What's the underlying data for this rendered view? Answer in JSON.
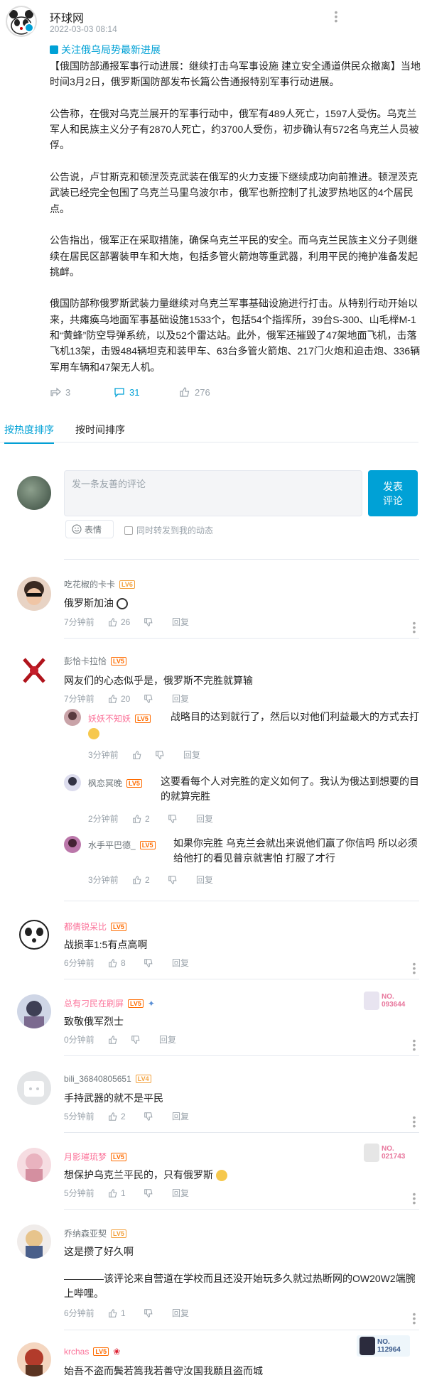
{
  "post": {
    "author": "环球网",
    "time": "2022-03-03 08:14",
    "topic": "关注俄乌局势最新进展",
    "paragraphs": [
      "【俄国防部通报军事行动进展：继续打击乌军事设施 建立安全通道供民众撤离】当地时间3月2日，俄罗斯国防部发布长篇公告通报特别军事行动进展。",
      "公告称，在俄对乌克兰展开的军事行动中，俄军有489人死亡，1597人受伤。乌克兰军人和民族主义分子有2870人死亡，约3700人受伤，初步确认有572名乌克兰人员被俘。",
      "公告说，卢甘斯克和顿涅茨克武装在俄军的火力支援下继续成功向前推进。顿涅茨克武装已经完全包围了乌克兰马里乌波尔市，俄军也新控制了扎波罗热地区的4个居民点。",
      "公告指出，俄军正在采取措施，确保乌克兰平民的安全。而乌克兰民族主义分子则继续在居民区部署装甲车和大炮，包括多管火箭炮等重武器，利用平民的掩护准备发起挑衅。",
      "俄国防部称俄罗斯武装力量继续对乌克兰军事基础设施进行打击。从特别行动开始以来，共瘫痪乌地面军事基础设施1533个，包括54个指挥所，39台S-300、山毛榉M-1和“黄蜂”防空导弹系统，以及52个雷达站。此外，俄军还摧毁了47架地面飞机，击落飞机13架，击毁484辆坦克和装甲车、63台多管火箭炮、217门火炮和迫击炮、336辆军用车辆和47架无人机。"
    ],
    "forward_count": "3",
    "comment_count": "31",
    "like_count": "276"
  },
  "tabs": {
    "hot": "按热度排序",
    "time": "按时间排序"
  },
  "composer": {
    "placeholder": "发一条友善的评论",
    "submit_line1": "发表",
    "submit_line2": "评论",
    "emoji_label": "表情",
    "forward_label": "同时转发到我的动态"
  },
  "reply_label": "回复",
  "colors": {
    "accent": "#00a1d6",
    "vip": "#fb7299",
    "level_orange": "#f2a03b",
    "level_red": "#ff6c00"
  },
  "comments": [
    {
      "name": "吃花椒的卡卡",
      "level": "LV6",
      "text": "俄罗斯加油",
      "time": "7分钟前",
      "likes": "26"
    },
    {
      "name": "彭恰卡拉恰",
      "level": "LV5",
      "text": "网友们的心态似乎是，俄罗斯不完胜就算输",
      "time": "7分钟前",
      "likes": "20",
      "replies": [
        {
          "name": "妖妖不知妖",
          "level": "LV5",
          "text": "战略目的达到就行了，然后以对他们利益最大的方式去打",
          "time": "3分钟前",
          "likes": ""
        },
        {
          "name": "枫恋冥晚",
          "level": "LV5",
          "text": "这要看每个人对完胜的定义如何了。我认为俄达到想要的目的就算完胜",
          "time": "2分钟前",
          "likes": "2"
        },
        {
          "name": "水手平巴德_",
          "level": "LV5",
          "text": "如果你完胜 乌克兰会就出来说他们赢了你信吗 所以必须给他打的看见普京就害怕 打服了才行",
          "time": "3分钟前",
          "likes": "2"
        }
      ]
    },
    {
      "name": "都倩锐呆比",
      "level": "LV5",
      "text": "战损率1:5有点高啊",
      "time": "6分钟前",
      "likes": "8"
    },
    {
      "name": "总有刁民在刷屏",
      "level": "LV5",
      "text": "致敬俄军烈士",
      "time": "0分钟前",
      "likes": "",
      "badge": "NO. 093644"
    },
    {
      "name": "bili_36840805651",
      "level": "LV4",
      "text": "手持武器的就不是平民",
      "time": "5分钟前",
      "likes": "2"
    },
    {
      "name": "月影璀琉梦",
      "level": "LV5",
      "text": "想保护乌克兰平民的，只有俄罗斯",
      "time": "5分钟前",
      "likes": "1",
      "badge": "NO. 021743"
    },
    {
      "name": "乔纳森亚契",
      "level": "LV5",
      "text": "这是攒了好久啊",
      "text2": "————该评论来自营道在学校而且还没开始玩多久就过热断网的OW20W2端腕上哔哩。",
      "time": "6分钟前",
      "likes": "1"
    },
    {
      "name": "krchas",
      "level": "LV5",
      "text": "始吾不盗而鬓若篙我若善守汝国我願且盗而城",
      "time": "",
      "likes": "",
      "badge": "NO. 112964"
    }
  ]
}
